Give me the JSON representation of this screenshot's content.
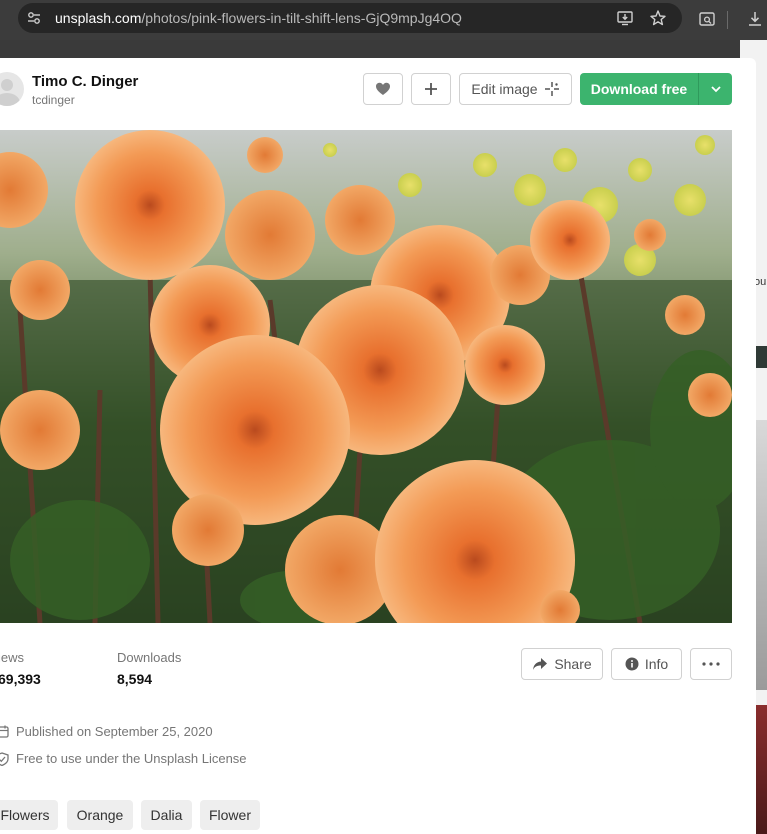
{
  "browser": {
    "url_host": "unsplash.com",
    "url_path": "/photos/pink-flowers-in-tilt-shift-lens-GjQ9mpJg4OQ"
  },
  "author": {
    "name": "Timo C. Dinger",
    "handle": "tcdinger"
  },
  "actions": {
    "edit_label": "Edit image",
    "download_label": "Download free"
  },
  "stats": {
    "views_label": "iews",
    "views_value": "69,393",
    "downloads_label": "Downloads",
    "downloads_value": "8,594"
  },
  "secondary_actions": {
    "share_label": "Share",
    "info_label": "Info"
  },
  "meta": {
    "published": "Published on September 25, 2020",
    "license": "Free to use under the Unsplash License"
  },
  "tags": [
    "Flowers",
    "Orange",
    "Dalia",
    "Flower"
  ],
  "colors": {
    "download_green": "#3cb46e",
    "dahlia_orange": "#f08a3c"
  },
  "icons": {
    "like": "heart-icon",
    "add": "plus-icon",
    "edit": "sparkle-icon",
    "download_dropdown": "chevron-down-icon",
    "share": "share-arrow-icon",
    "info": "info-circle-icon",
    "more": "ellipsis-icon",
    "published": "calendar-icon",
    "license": "shield-check-icon"
  }
}
